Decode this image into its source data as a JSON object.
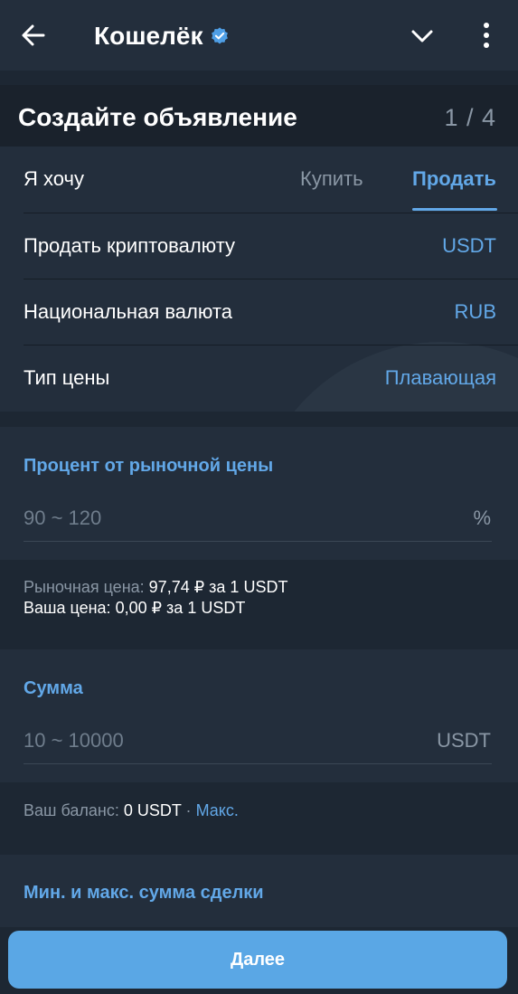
{
  "header": {
    "title": "Кошелёк",
    "icons": [
      "arrow-left-icon",
      "verified-icon",
      "chevron-down-icon",
      "more-vertical-icon"
    ]
  },
  "page": {
    "title": "Создайте объявление",
    "step": "1 / 4"
  },
  "settings": {
    "want_label": "Я хочу",
    "buy_tab": "Купить",
    "sell_tab": "Продать",
    "crypto_label": "Продать криптовалюту",
    "crypto_value": "USDT",
    "fiat_label": "Национальная валюта",
    "fiat_value": "RUB",
    "price_type_label": "Тип цены",
    "price_type_value": "Плавающая"
  },
  "percent_section": {
    "title": "Процент от рыночной цены",
    "placeholder": "90 ~ 120",
    "unit": "%"
  },
  "price_info": {
    "market_label": "Рыночная цена:",
    "market_value": "97,74 ₽ за 1 USDT",
    "your_label": "Ваша цена:",
    "your_value": "0,00 ₽ за 1 USDT"
  },
  "amount_section": {
    "title": "Сумма",
    "placeholder": "10 ~ 10000",
    "unit": "USDT"
  },
  "balance_info": {
    "label": "Ваш баланс:",
    "value": "0 USDT",
    "separator": "·",
    "max_link": "Макс."
  },
  "limits_section": {
    "title": "Мин. и макс. сумма сделки"
  },
  "footer": {
    "next_button": "Далее"
  },
  "colors": {
    "background": "#1d2733",
    "card": "#232e3c",
    "accent": "#62a8e8",
    "button": "#5aa7e5",
    "muted": "#8a97a5"
  }
}
